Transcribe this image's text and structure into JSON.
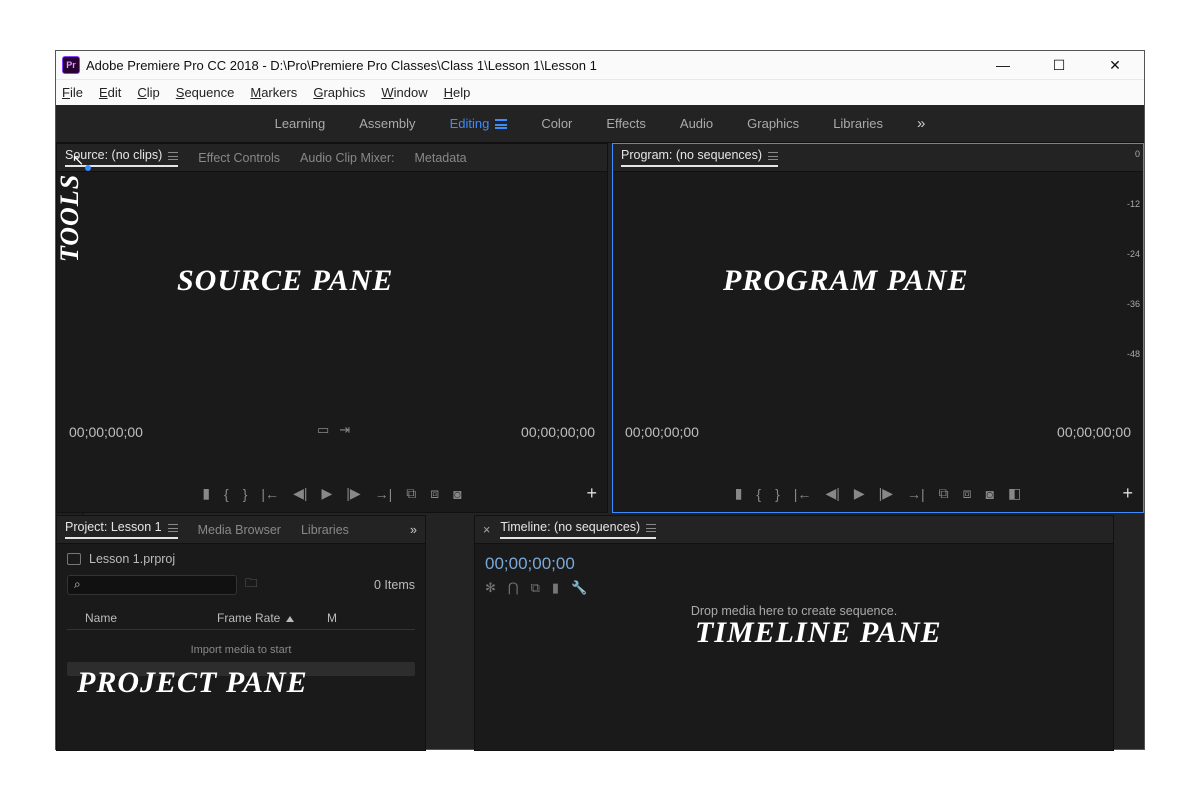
{
  "title": "Adobe Premiere Pro CC 2018 - D:\\Pro\\Premiere Pro Classes\\Class 1\\Lesson 1\\Lesson 1",
  "menus": {
    "file": "File",
    "edit": "Edit",
    "clip": "Clip",
    "sequence": "Sequence",
    "markers": "Markers",
    "graphics": "Graphics",
    "window": "Window",
    "help": "Help"
  },
  "workspaces": {
    "learning": "Learning",
    "assembly": "Assembly",
    "editing": "Editing",
    "color": "Color",
    "effects": "Effects",
    "audio": "Audio",
    "graphics": "Graphics",
    "libraries": "Libraries",
    "more": "»"
  },
  "source": {
    "tabs": {
      "source": "Source: (no clips)",
      "effect_controls": "Effect Controls",
      "audio_mixer": "Audio Clip Mixer:",
      "metadata": "Metadata"
    },
    "tc_left": "00;00;00;00",
    "tc_right": "00;00;00;00"
  },
  "program": {
    "tab": "Program: (no sequences)",
    "tc_left": "00;00;00;00",
    "tc_right": "00;00;00;00"
  },
  "project": {
    "tabs": {
      "project": "Project: Lesson 1",
      "media_browser": "Media Browser",
      "libraries": "Libraries",
      "more": "»"
    },
    "filename": "Lesson 1.prproj",
    "search_placeholder": "",
    "item_count": "0 Items",
    "col_name": "Name",
    "col_framerate": "Frame Rate",
    "col_m": "M",
    "empty_msg": "Import media to start"
  },
  "timeline": {
    "close": "×",
    "tab": "Timeline: (no sequences)",
    "tc": "00;00;00;00",
    "drop_msg": "Drop media here to create sequence."
  },
  "audio_ticks": [
    "0",
    "-12",
    "-24",
    "-36",
    "-48"
  ],
  "annotations": {
    "source": "SOURCE PANE",
    "program": "PROGRAM PANE",
    "project": "PROJECT PANE",
    "timeline": "TIMELINE PANE",
    "tools": "TOOLS"
  }
}
